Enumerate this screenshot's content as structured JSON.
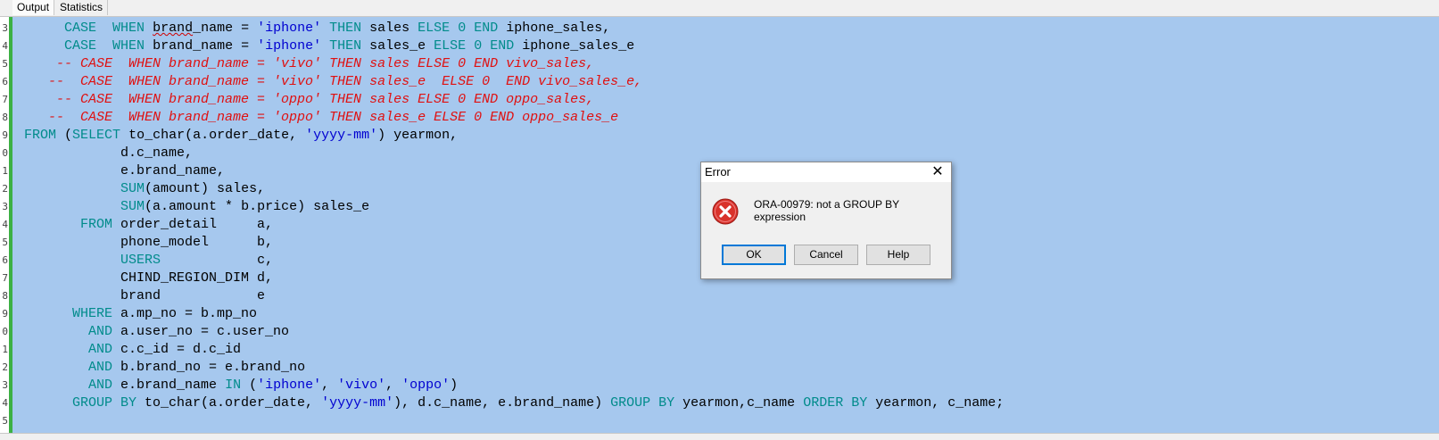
{
  "tabs": [
    "Output",
    "Statistics"
  ],
  "gutter": [
    "3",
    "4",
    "5",
    "6",
    "7",
    "8",
    "9",
    "0",
    "1",
    "2",
    "3",
    "4",
    "5",
    "6",
    "7",
    "8",
    "9",
    "0",
    "1",
    "2",
    "3",
    "4",
    "5"
  ],
  "code_lines": [
    [
      [
        "      ",
        ""
      ],
      [
        "CASE",
        "kw"
      ],
      [
        "  ",
        ""
      ],
      [
        "WHEN",
        "kw"
      ],
      [
        " ",
        ""
      ],
      [
        "brand",
        "squiggle"
      ],
      [
        "_name = ",
        ""
      ],
      [
        "'iphone'",
        "str"
      ],
      [
        " ",
        ""
      ],
      [
        "THEN",
        "kw"
      ],
      [
        " sales ",
        ""
      ],
      [
        "ELSE",
        "kw"
      ],
      [
        " ",
        ""
      ],
      [
        "0",
        "num"
      ],
      [
        " ",
        ""
      ],
      [
        "END",
        "kw"
      ],
      [
        " iphone_sales,",
        ""
      ]
    ],
    [
      [
        "      ",
        ""
      ],
      [
        "CASE",
        "kw"
      ],
      [
        "  ",
        ""
      ],
      [
        "WHEN",
        "kw"
      ],
      [
        " brand_name = ",
        ""
      ],
      [
        "'iphone'",
        "str"
      ],
      [
        " ",
        ""
      ],
      [
        "THEN",
        "kw"
      ],
      [
        " sales_e ",
        ""
      ],
      [
        "ELSE",
        "kw"
      ],
      [
        " ",
        ""
      ],
      [
        "0",
        "num"
      ],
      [
        " ",
        ""
      ],
      [
        "END",
        "kw"
      ],
      [
        " iphone_sales_e",
        ""
      ]
    ],
    [
      [
        "     -- CASE  WHEN brand_name = 'vivo' THEN sales ELSE 0 END vivo_sales,",
        "cmt"
      ]
    ],
    [
      [
        "    --  CASE  WHEN brand_name = 'vivo' THEN sales_e  ELSE 0  END vivo_sales_e,",
        "cmt"
      ]
    ],
    [
      [
        "     -- CASE  WHEN brand_name = 'oppo' THEN sales ELSE 0 END oppo_sales,",
        "cmt"
      ]
    ],
    [
      [
        "    --  CASE  WHEN brand_name = 'oppo' THEN sales_e ELSE 0 END oppo_sales_e",
        "cmt"
      ]
    ],
    [
      [
        " ",
        ""
      ],
      [
        "FROM",
        "kw"
      ],
      [
        " (",
        ""
      ],
      [
        "SELECT",
        "kw"
      ],
      [
        " to_char(a.order_date, ",
        ""
      ],
      [
        "'yyyy-mm'",
        "str"
      ],
      [
        ") yearmon,",
        ""
      ]
    ],
    [
      [
        "             d.c_name,",
        ""
      ]
    ],
    [
      [
        "             e.brand_name,",
        ""
      ]
    ],
    [
      [
        "             ",
        ""
      ],
      [
        "SUM",
        "kw"
      ],
      [
        "(amount) sales,",
        ""
      ]
    ],
    [
      [
        "             ",
        ""
      ],
      [
        "SUM",
        "kw"
      ],
      [
        "(a.amount * b.price) sales_e",
        ""
      ]
    ],
    [
      [
        "        ",
        ""
      ],
      [
        "FROM",
        "kw"
      ],
      [
        " order_detail     a,",
        ""
      ]
    ],
    [
      [
        "             phone_model      b,",
        ""
      ]
    ],
    [
      [
        "             ",
        ""
      ],
      [
        "USERS",
        "kw"
      ],
      [
        "            c,",
        ""
      ]
    ],
    [
      [
        "             CHIND_REGION_DIM d,",
        ""
      ]
    ],
    [
      [
        "             brand            e",
        ""
      ]
    ],
    [
      [
        "       ",
        ""
      ],
      [
        "WHERE",
        "kw"
      ],
      [
        " a.mp_no = b.mp_no",
        ""
      ]
    ],
    [
      [
        "         ",
        ""
      ],
      [
        "AND",
        "kw"
      ],
      [
        " a.user_no = c.user_no",
        ""
      ]
    ],
    [
      [
        "         ",
        ""
      ],
      [
        "AND",
        "kw"
      ],
      [
        " c.c_id = d.c_id",
        ""
      ]
    ],
    [
      [
        "         ",
        ""
      ],
      [
        "AND",
        "kw"
      ],
      [
        " b.brand_no = e.brand_no",
        ""
      ]
    ],
    [
      [
        "         ",
        ""
      ],
      [
        "AND",
        "kw"
      ],
      [
        " e.brand_name ",
        ""
      ],
      [
        "IN",
        "kw"
      ],
      [
        " (",
        ""
      ],
      [
        "'iphone'",
        "str"
      ],
      [
        ", ",
        ""
      ],
      [
        "'vivo'",
        "str"
      ],
      [
        ", ",
        ""
      ],
      [
        "'oppo'",
        "str"
      ],
      [
        ")",
        ""
      ]
    ],
    [
      [
        "       ",
        ""
      ],
      [
        "GROUP BY",
        "kw"
      ],
      [
        " to_char(a.order_date, ",
        ""
      ],
      [
        "'yyyy-mm'",
        "str"
      ],
      [
        "), d.c_name, e.brand_name) ",
        ""
      ],
      [
        "GROUP BY",
        "kw"
      ],
      [
        " yearmon,c_name ",
        ""
      ],
      [
        "ORDER BY",
        "kw"
      ],
      [
        " yearmon, c_name;",
        ""
      ]
    ],
    [
      [
        "",
        ""
      ]
    ]
  ],
  "dialog": {
    "title": "Error",
    "close_icon": "close-icon",
    "icon": "error-icon",
    "message": "ORA-00979: not a GROUP BY expression",
    "ok_label": "OK",
    "cancel_label": "Cancel",
    "help_label": "Help"
  },
  "colors": {
    "selection": "#a6c8ee",
    "keyword": "#008b8b",
    "string": "#0000d0",
    "comment": "#e01010",
    "error_icon": "#d9322b"
  }
}
